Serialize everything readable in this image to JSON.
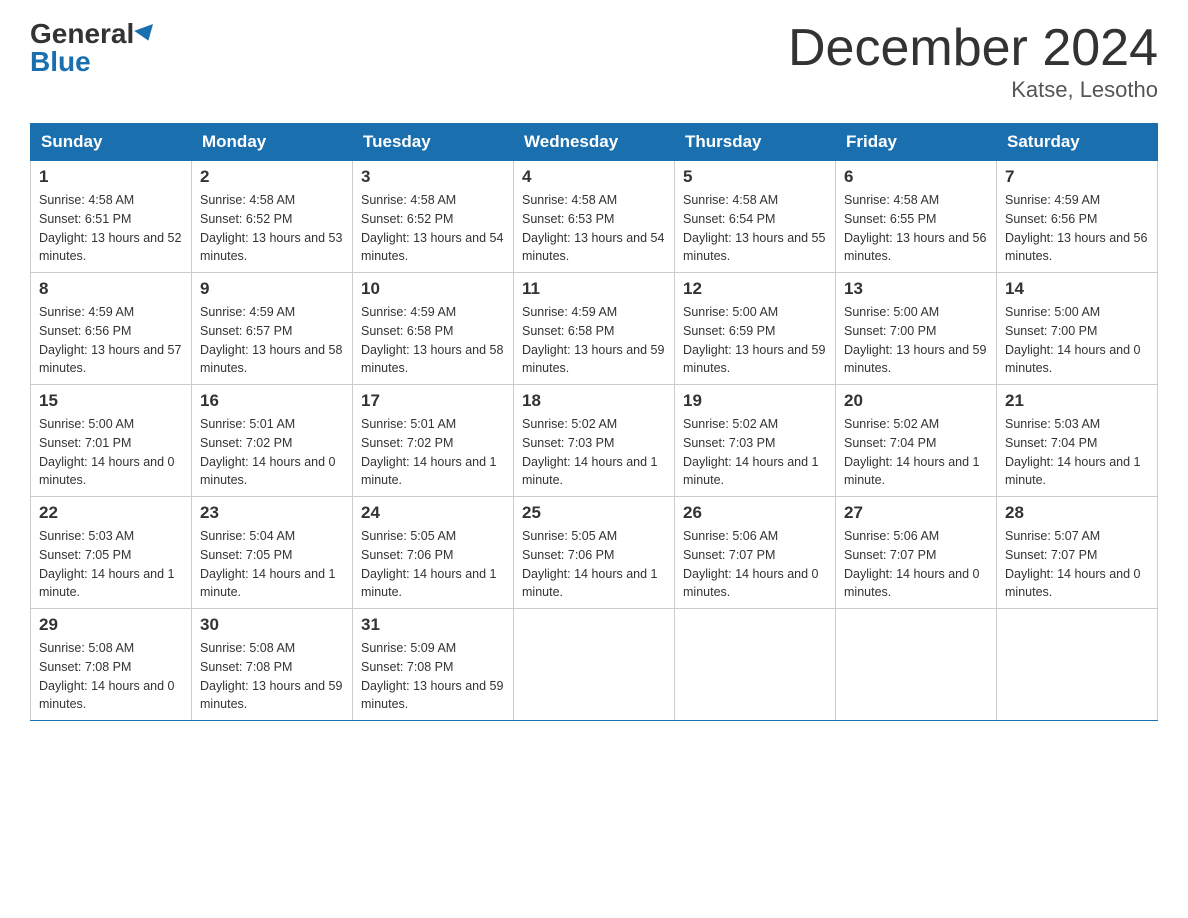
{
  "header": {
    "logo_general": "General",
    "logo_blue": "Blue",
    "month_title": "December 2024",
    "location": "Katse, Lesotho"
  },
  "days_of_week": [
    "Sunday",
    "Monday",
    "Tuesday",
    "Wednesday",
    "Thursday",
    "Friday",
    "Saturday"
  ],
  "weeks": [
    [
      {
        "day": "1",
        "sunrise": "4:58 AM",
        "sunset": "6:51 PM",
        "daylight": "13 hours and 52 minutes."
      },
      {
        "day": "2",
        "sunrise": "4:58 AM",
        "sunset": "6:52 PM",
        "daylight": "13 hours and 53 minutes."
      },
      {
        "day": "3",
        "sunrise": "4:58 AM",
        "sunset": "6:52 PM",
        "daylight": "13 hours and 54 minutes."
      },
      {
        "day": "4",
        "sunrise": "4:58 AM",
        "sunset": "6:53 PM",
        "daylight": "13 hours and 54 minutes."
      },
      {
        "day": "5",
        "sunrise": "4:58 AM",
        "sunset": "6:54 PM",
        "daylight": "13 hours and 55 minutes."
      },
      {
        "day": "6",
        "sunrise": "4:58 AM",
        "sunset": "6:55 PM",
        "daylight": "13 hours and 56 minutes."
      },
      {
        "day": "7",
        "sunrise": "4:59 AM",
        "sunset": "6:56 PM",
        "daylight": "13 hours and 56 minutes."
      }
    ],
    [
      {
        "day": "8",
        "sunrise": "4:59 AM",
        "sunset": "6:56 PM",
        "daylight": "13 hours and 57 minutes."
      },
      {
        "day": "9",
        "sunrise": "4:59 AM",
        "sunset": "6:57 PM",
        "daylight": "13 hours and 58 minutes."
      },
      {
        "day": "10",
        "sunrise": "4:59 AM",
        "sunset": "6:58 PM",
        "daylight": "13 hours and 58 minutes."
      },
      {
        "day": "11",
        "sunrise": "4:59 AM",
        "sunset": "6:58 PM",
        "daylight": "13 hours and 59 minutes."
      },
      {
        "day": "12",
        "sunrise": "5:00 AM",
        "sunset": "6:59 PM",
        "daylight": "13 hours and 59 minutes."
      },
      {
        "day": "13",
        "sunrise": "5:00 AM",
        "sunset": "7:00 PM",
        "daylight": "13 hours and 59 minutes."
      },
      {
        "day": "14",
        "sunrise": "5:00 AM",
        "sunset": "7:00 PM",
        "daylight": "14 hours and 0 minutes."
      }
    ],
    [
      {
        "day": "15",
        "sunrise": "5:00 AM",
        "sunset": "7:01 PM",
        "daylight": "14 hours and 0 minutes."
      },
      {
        "day": "16",
        "sunrise": "5:01 AM",
        "sunset": "7:02 PM",
        "daylight": "14 hours and 0 minutes."
      },
      {
        "day": "17",
        "sunrise": "5:01 AM",
        "sunset": "7:02 PM",
        "daylight": "14 hours and 1 minute."
      },
      {
        "day": "18",
        "sunrise": "5:02 AM",
        "sunset": "7:03 PM",
        "daylight": "14 hours and 1 minute."
      },
      {
        "day": "19",
        "sunrise": "5:02 AM",
        "sunset": "7:03 PM",
        "daylight": "14 hours and 1 minute."
      },
      {
        "day": "20",
        "sunrise": "5:02 AM",
        "sunset": "7:04 PM",
        "daylight": "14 hours and 1 minute."
      },
      {
        "day": "21",
        "sunrise": "5:03 AM",
        "sunset": "7:04 PM",
        "daylight": "14 hours and 1 minute."
      }
    ],
    [
      {
        "day": "22",
        "sunrise": "5:03 AM",
        "sunset": "7:05 PM",
        "daylight": "14 hours and 1 minute."
      },
      {
        "day": "23",
        "sunrise": "5:04 AM",
        "sunset": "7:05 PM",
        "daylight": "14 hours and 1 minute."
      },
      {
        "day": "24",
        "sunrise": "5:05 AM",
        "sunset": "7:06 PM",
        "daylight": "14 hours and 1 minute."
      },
      {
        "day": "25",
        "sunrise": "5:05 AM",
        "sunset": "7:06 PM",
        "daylight": "14 hours and 1 minute."
      },
      {
        "day": "26",
        "sunrise": "5:06 AM",
        "sunset": "7:07 PM",
        "daylight": "14 hours and 0 minutes."
      },
      {
        "day": "27",
        "sunrise": "5:06 AM",
        "sunset": "7:07 PM",
        "daylight": "14 hours and 0 minutes."
      },
      {
        "day": "28",
        "sunrise": "5:07 AM",
        "sunset": "7:07 PM",
        "daylight": "14 hours and 0 minutes."
      }
    ],
    [
      {
        "day": "29",
        "sunrise": "5:08 AM",
        "sunset": "7:08 PM",
        "daylight": "14 hours and 0 minutes."
      },
      {
        "day": "30",
        "sunrise": "5:08 AM",
        "sunset": "7:08 PM",
        "daylight": "13 hours and 59 minutes."
      },
      {
        "day": "31",
        "sunrise": "5:09 AM",
        "sunset": "7:08 PM",
        "daylight": "13 hours and 59 minutes."
      },
      null,
      null,
      null,
      null
    ]
  ],
  "labels": {
    "sunrise": "Sunrise:",
    "sunset": "Sunset:",
    "daylight": "Daylight:"
  }
}
